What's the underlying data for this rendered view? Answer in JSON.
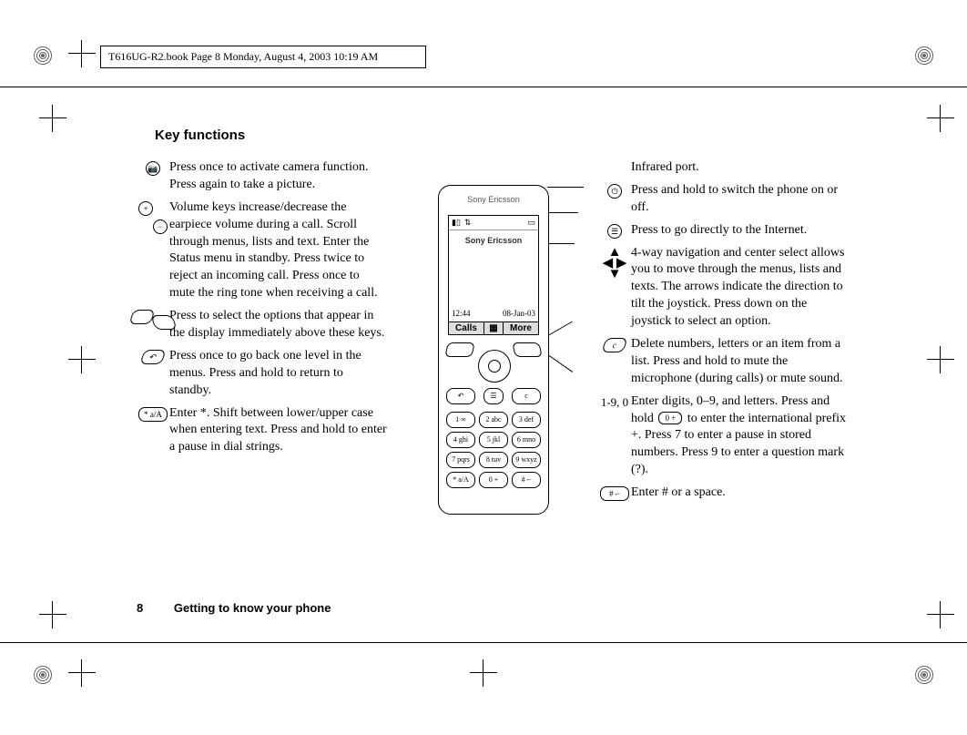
{
  "header_box": "T616UG-R2.book  Page 8  Monday, August 4, 2003  10:19 AM",
  "section_title": "Key functions",
  "footer": {
    "page_number": "8",
    "section": "Getting to know your phone"
  },
  "phone": {
    "brand": "Sony Ericsson",
    "screen_brand": "Sony Ericsson",
    "time": "12:44",
    "date": "08-Jan-03",
    "soft_left": "Calls",
    "soft_right": "More",
    "keypad": [
      [
        "1 ∞",
        "2 abc",
        "3 def"
      ],
      [
        "4 ghi",
        "5 jkl",
        "6 mno"
      ],
      [
        "7 pqrs",
        "8 tuv",
        "9 wxyz"
      ],
      [
        "* a/A",
        "0 +",
        "# ⌐"
      ]
    ]
  },
  "left": [
    {
      "icon": "camera-key-icon",
      "glyph": "📷",
      "text": "Press once to activate camera function. Press again to take a picture."
    },
    {
      "icon": "volume-up-key-icon",
      "glyph": "+",
      "text": "Volume keys increase/decrease the earpiece volume during a call. Scroll through menus, lists and text. Enter the Status menu in standby. Press twice to reject an incoming call. Press once to mute the ring tone when receiving a call.",
      "extra_icon": "volume-down-key-icon",
      "extra_glyph": "−"
    },
    {
      "icon": "softkey-left-icon",
      "glyph": "",
      "text": "Press to select the options that appear in the display immediately above these keys.",
      "extra_icon": "softkey-right-icon",
      "extra_glyph": ""
    },
    {
      "icon": "back-key-icon",
      "glyph": "↶",
      "text": "Press once to go back one level in the menus. Press and hold to return to standby."
    },
    {
      "icon": "star-key-icon",
      "glyph": "* a/A",
      "text": "Enter *.\nShift between lower/upper case when entering text.\nPress and hold to enter a pause in dial strings."
    }
  ],
  "right": [
    {
      "icon": "infrared-port-icon",
      "glyph": "",
      "text": "Infrared port.",
      "plain_label": ""
    },
    {
      "icon": "power-key-icon",
      "glyph": "⏻",
      "text": "Press and hold to switch the phone on or off."
    },
    {
      "icon": "internet-key-icon",
      "glyph": "☰",
      "text": "Press to go directly to the Internet."
    },
    {
      "icon": "joystick-icon",
      "glyph": "arrows",
      "text": "4-way navigation and center select allows you to move through the menus, lists and texts. The arrows indicate the direction to tilt the joystick. Press down on the joystick to select an option."
    },
    {
      "icon": "clear-key-icon",
      "glyph": "c",
      "text": "Delete numbers, letters or an item from a list. Press and hold to mute the microphone (during calls) or mute sound."
    },
    {
      "icon": "digit-keys-icon",
      "plain_label": "1-9, 0",
      "text": "Enter digits, 0–9, and letters. Press and hold {0KEY} to enter the international prefix +. Press 7 to enter a pause in stored numbers. Press 9 to enter a question mark (?).",
      "inline_key_label": "0 +"
    },
    {
      "icon": "hash-key-icon",
      "glyph": "# ⌐",
      "text": "Enter # or a space."
    }
  ]
}
